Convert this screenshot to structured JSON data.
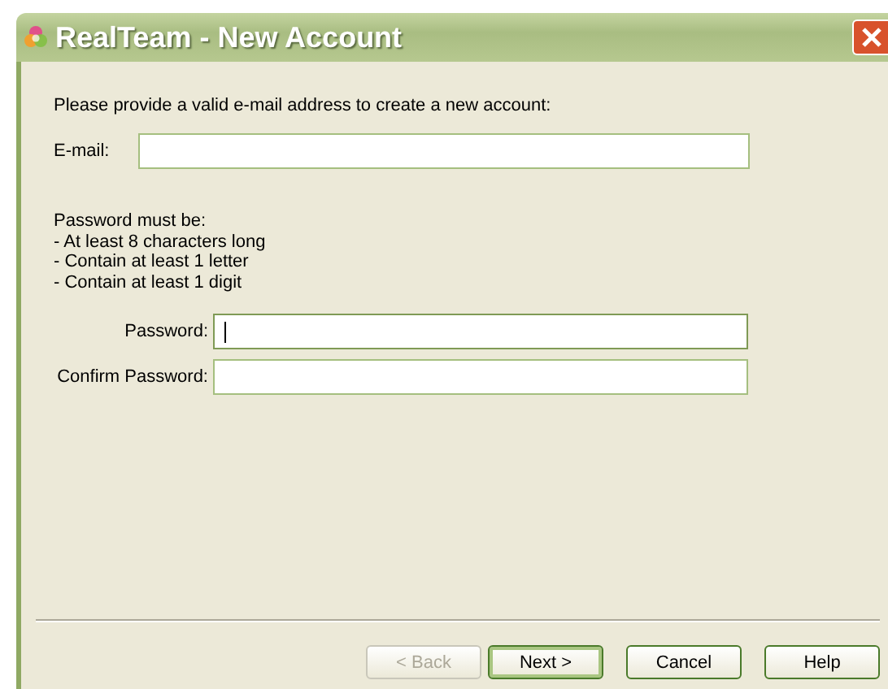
{
  "window": {
    "title": "RealTeam - New Account"
  },
  "intro": "Please provide a valid e-mail address to create a new account:",
  "email": {
    "label": "E-mail:",
    "focused": false
  },
  "rules": [
    "Password must be:",
    "- At least 8 characters long",
    "- Contain at least 1 letter",
    "- Contain at least 1 digit"
  ],
  "password_fields": [
    {
      "label": "Password:",
      "focused": true
    },
    {
      "label": "Confirm Password:",
      "focused": false
    }
  ],
  "buttons": [
    {
      "label": "< Back",
      "disabled": true,
      "default": false
    },
    {
      "label": "Next >",
      "disabled": false,
      "default": true
    },
    {
      "label": "Cancel",
      "disabled": false,
      "default": false
    },
    {
      "label": "Help",
      "disabled": false,
      "default": false
    }
  ]
}
